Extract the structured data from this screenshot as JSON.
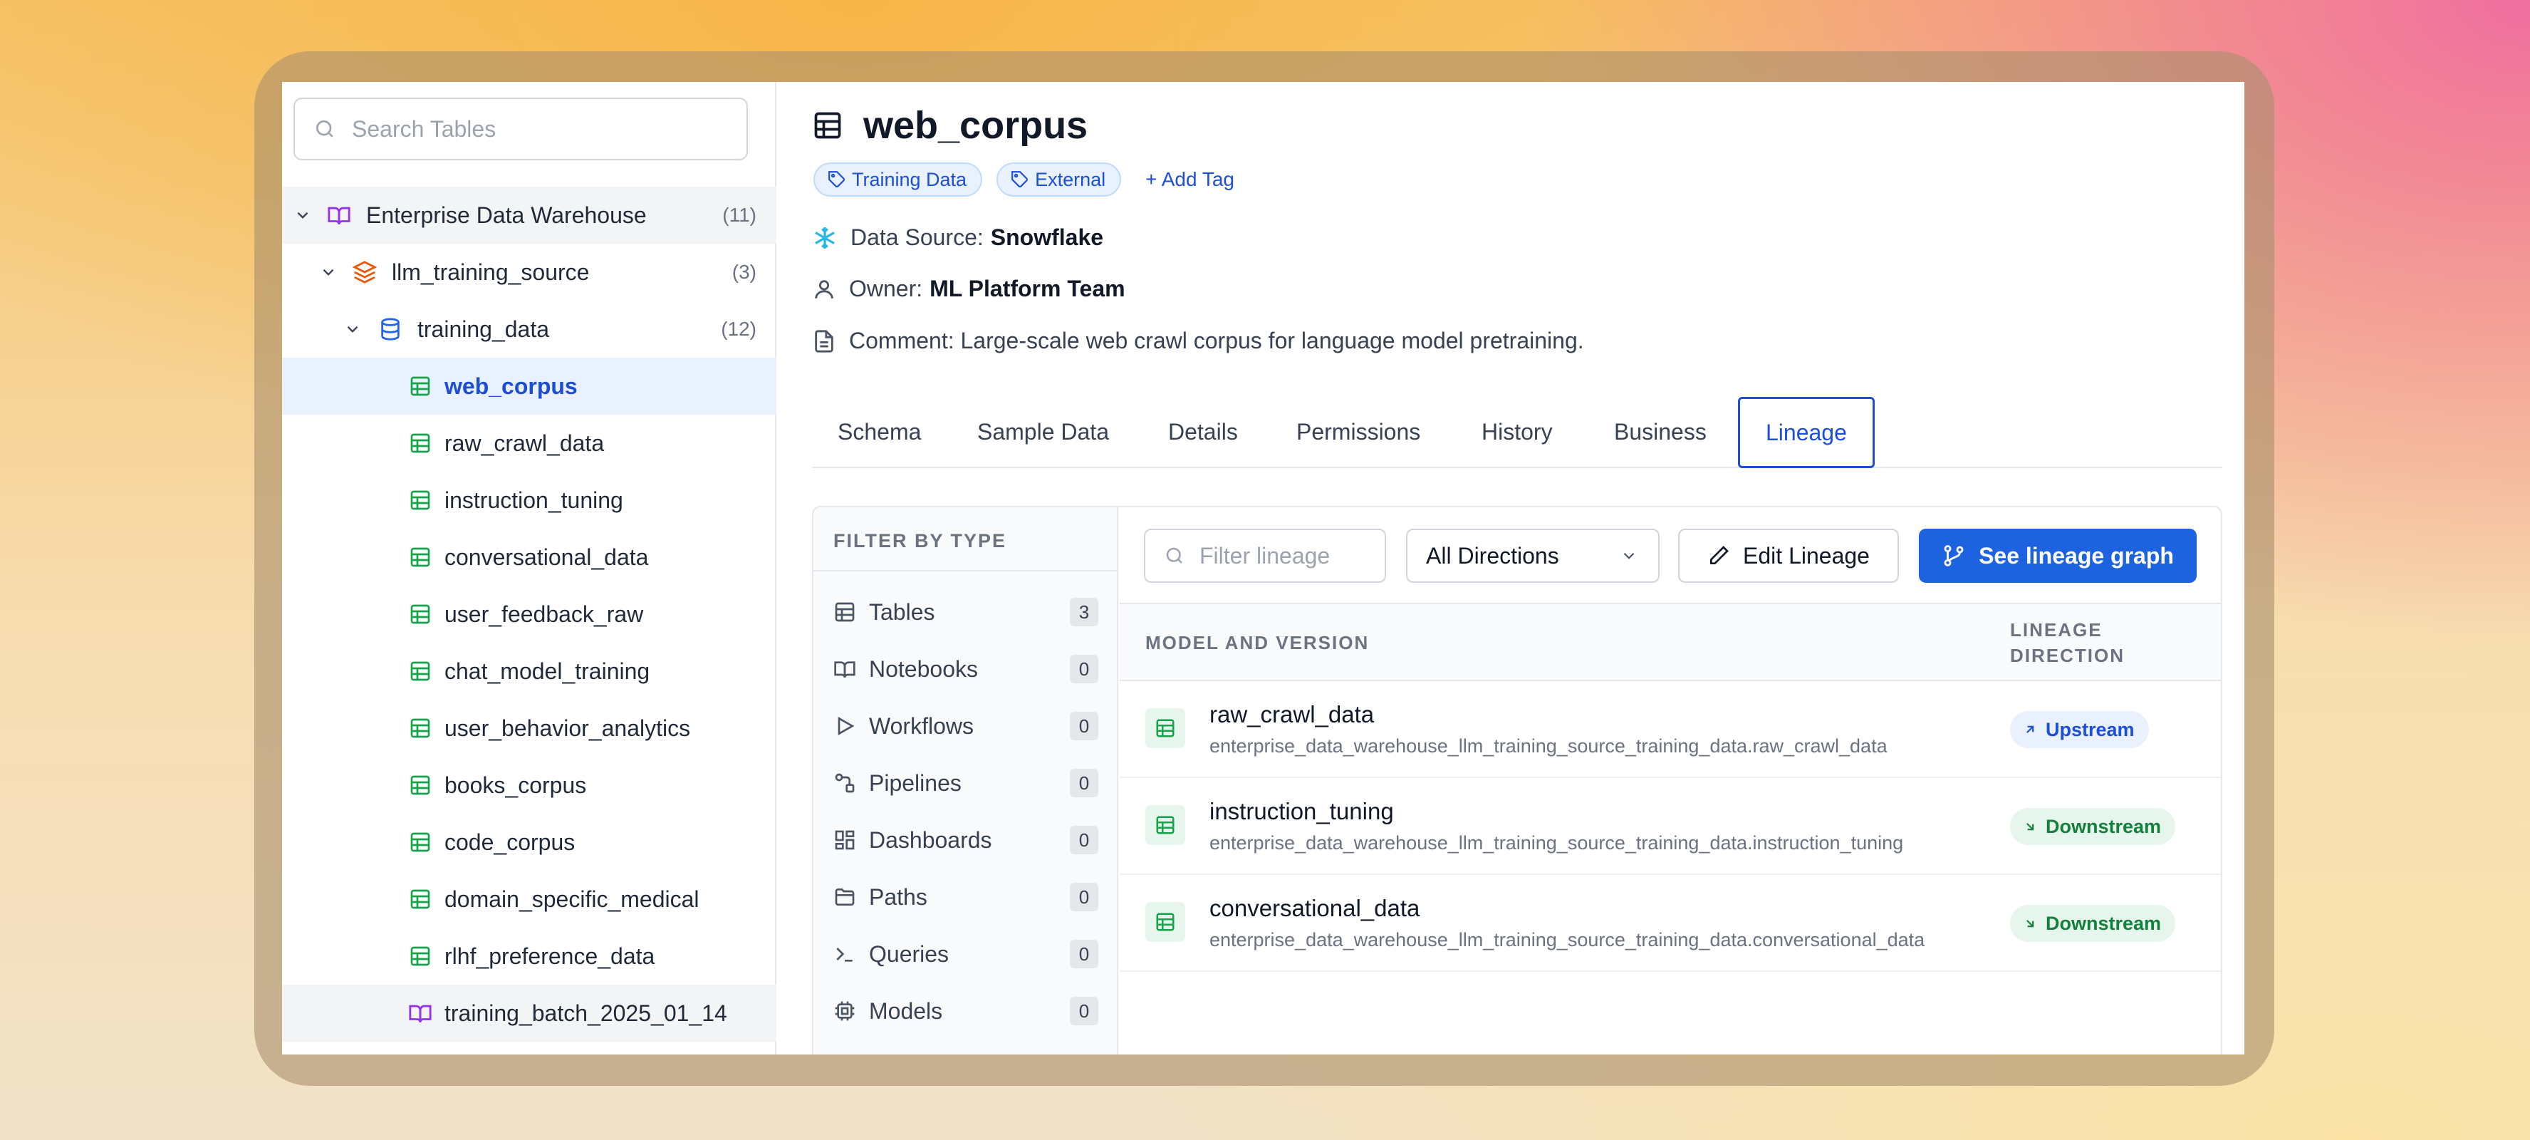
{
  "sidebar": {
    "search_placeholder": "Search Tables",
    "tree": [
      {
        "label": "Enterprise Data Warehouse",
        "count": "(11)",
        "icon": "book-icon"
      },
      {
        "label": "llm_training_source",
        "count": "(3)",
        "icon": "layers-icon"
      },
      {
        "label": "training_data",
        "count": "(12)",
        "icon": "database-icon"
      },
      {
        "label": "web_corpus",
        "icon": "table-icon",
        "selected": true
      },
      {
        "label": "raw_crawl_data",
        "icon": "table-icon"
      },
      {
        "label": "instruction_tuning",
        "icon": "table-icon"
      },
      {
        "label": "conversational_data",
        "icon": "table-icon"
      },
      {
        "label": "user_feedback_raw",
        "icon": "table-icon"
      },
      {
        "label": "chat_model_training",
        "icon": "table-icon"
      },
      {
        "label": "user_behavior_analytics",
        "icon": "table-icon"
      },
      {
        "label": "books_corpus",
        "icon": "table-icon"
      },
      {
        "label": "code_corpus",
        "icon": "table-icon"
      },
      {
        "label": "domain_specific_medical",
        "icon": "table-icon"
      },
      {
        "label": "rlhf_preference_data",
        "icon": "table-icon"
      },
      {
        "label": "training_batch_2025_01_14",
        "icon": "notebook-icon"
      }
    ]
  },
  "header": {
    "title": "web_corpus",
    "tags": [
      "Training Data",
      "External"
    ],
    "add_tag": "+ Add Tag",
    "data_source_label": "Data Source:",
    "data_source_value": "Snowflake",
    "owner_label": "Owner:",
    "owner_value": "ML Platform Team",
    "comment": "Comment: Large-scale web crawl corpus for language model pretraining."
  },
  "tabs": [
    "Schema",
    "Sample Data",
    "Details",
    "Permissions",
    "History",
    "Business",
    "Lineage"
  ],
  "active_tab": "Lineage",
  "lineage": {
    "filter_heading": "FILTER BY TYPE",
    "filters": [
      {
        "label": "Tables",
        "count": "3",
        "icon": "table-icon"
      },
      {
        "label": "Notebooks",
        "count": "0",
        "icon": "notebook-icon"
      },
      {
        "label": "Workflows",
        "count": "0",
        "icon": "play-icon"
      },
      {
        "label": "Pipelines",
        "count": "0",
        "icon": "pipeline-icon"
      },
      {
        "label": "Dashboards",
        "count": "0",
        "icon": "dashboard-icon"
      },
      {
        "label": "Paths",
        "count": "0",
        "icon": "folder-icon"
      },
      {
        "label": "Queries",
        "count": "0",
        "icon": "terminal-icon"
      },
      {
        "label": "Models",
        "count": "0",
        "icon": "cpu-icon"
      }
    ],
    "filter_placeholder": "Filter lineage",
    "direction_select": "All Directions",
    "edit_button": "Edit Lineage",
    "graph_button": "See lineage graph",
    "col_model": "MODEL AND VERSION",
    "col_direction_1": "LINEAGE",
    "col_direction_2": "DIRECTION",
    "rows": [
      {
        "name": "raw_crawl_data",
        "path": "enterprise_data_warehouse_llm_training_source_training_data.raw_crawl_data",
        "direction": "Upstream"
      },
      {
        "name": "instruction_tuning",
        "path": "enterprise_data_warehouse_llm_training_source_training_data.instruction_tuning",
        "direction": "Downstream"
      },
      {
        "name": "conversational_data",
        "path": "enterprise_data_warehouse_llm_training_source_training_data.conversational_data",
        "direction": "Downstream"
      }
    ]
  },
  "colors": {
    "accent": "#1d63e0",
    "table_icon": "#16a34a",
    "notebook_icon": "#9333ea",
    "layers_icon": "#ea580c",
    "database_icon": "#2563eb",
    "snowflake": "#29b5e8"
  }
}
